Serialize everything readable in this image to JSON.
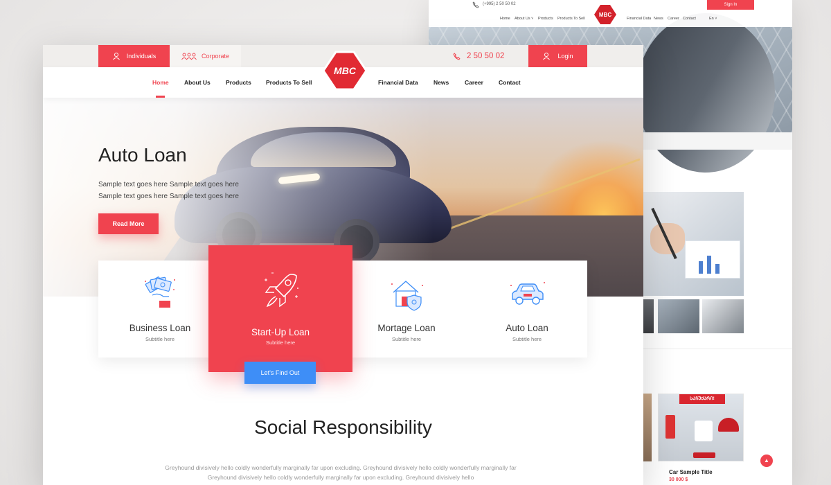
{
  "back": {
    "phone": "(+995) 2 50 50 02",
    "signin": "Sign In",
    "nav": [
      "Home",
      "About Us ˅",
      "Products",
      "Products To Sell",
      "Financial Data",
      "News",
      "Career",
      "Contact",
      "En ˅"
    ],
    "ribbon": "ᲡᲐᲩᲣᲥᲐᲠᲘ!",
    "product_title": "Car Sample Title",
    "product_price": "30 000 $"
  },
  "topbar": {
    "individuals": "Individuals",
    "corporate": "Corporate",
    "phone": "2 50 50 02",
    "login": "Login"
  },
  "logo_text": "MBC",
  "nav": {
    "items": [
      {
        "label": "Home",
        "active": true
      },
      {
        "label": "About Us"
      },
      {
        "label": "Products"
      },
      {
        "label": "Products To Sell"
      },
      {
        "label": "Financial Data"
      },
      {
        "label": "News"
      },
      {
        "label": "Career"
      },
      {
        "label": "Contact"
      }
    ]
  },
  "hero": {
    "title": "Auto Loan",
    "text_line1": "Sample text goes here Sample text goes here",
    "text_line2": "Sample text goes here Sample text goes here",
    "button": "Read More"
  },
  "services": [
    {
      "title": "Business Loan",
      "subtitle": "Subtitle here",
      "icon": "money-hand-icon"
    },
    {
      "title": "Start-Up Loan",
      "subtitle": "Subtitle here",
      "icon": "rocket-icon",
      "active": true
    },
    {
      "title": "Mortage Loan",
      "subtitle": "Subtitle here",
      "icon": "house-shield-icon"
    },
    {
      "title": "Auto Loan",
      "subtitle": "Subtitle here",
      "icon": "car-icon"
    }
  ],
  "find_button": "Let's Find Out",
  "social": {
    "title": "Social Responsibility",
    "line1": "Greyhound divisively hello coldly wonderfully marginally far upon excluding. Greyhound divisively hello coldly wonderfully marginally far",
    "line2": "Greyhound divisively hello coldly wonderfully marginally far upon excluding.  Greyhound divisively hello"
  },
  "colors": {
    "accent": "#f0434f",
    "blue": "#3e8ef7"
  }
}
